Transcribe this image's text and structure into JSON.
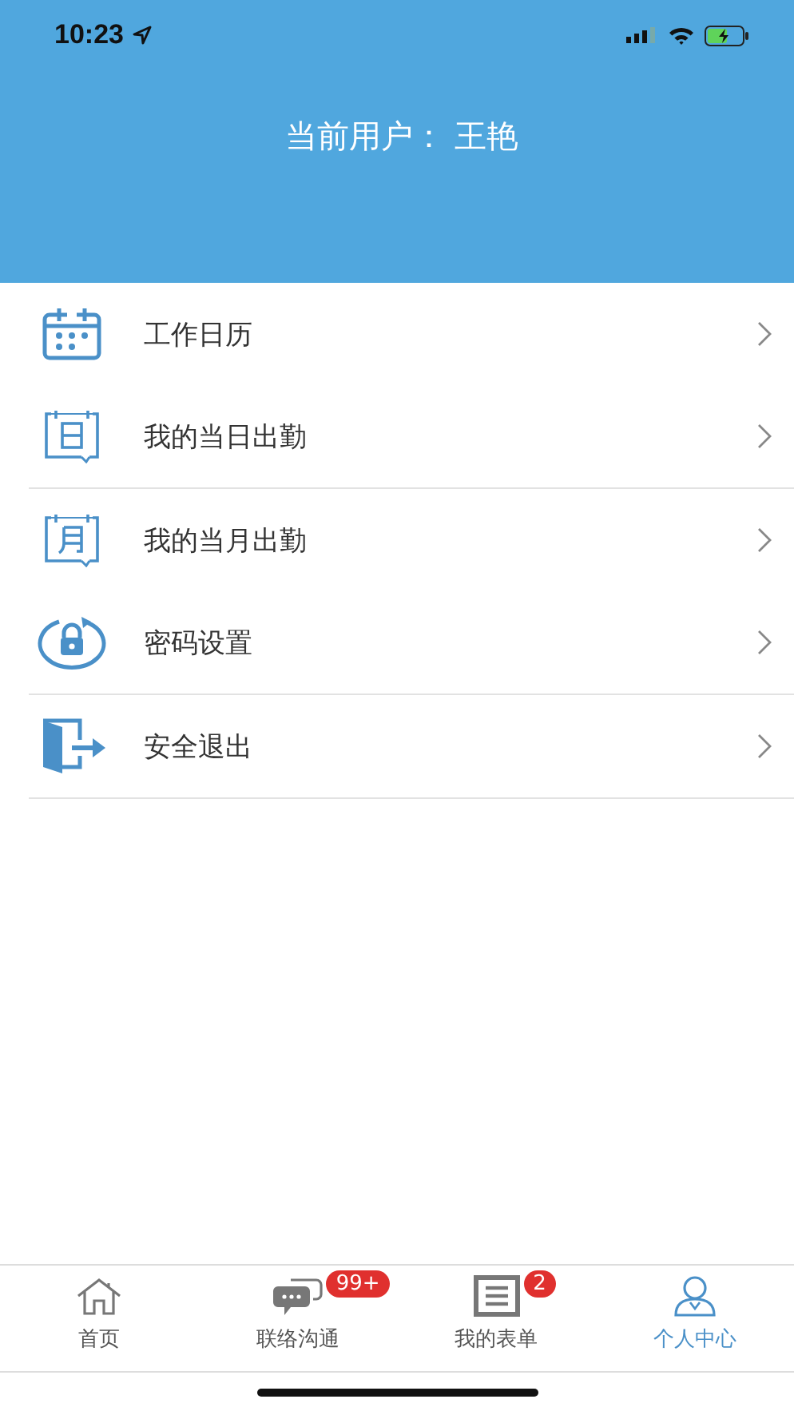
{
  "status_bar": {
    "time": "10:23"
  },
  "header": {
    "title": "当前用户： 王艳"
  },
  "menu_groups": [
    {
      "items": [
        {
          "label": "工作日历"
        },
        {
          "label": "我的当日出勤"
        }
      ]
    },
    {
      "items": [
        {
          "label": "我的当月出勤"
        },
        {
          "label": "密码设置"
        }
      ]
    },
    {
      "items": [
        {
          "label": "安全退出"
        }
      ]
    }
  ],
  "tab_bar": [
    {
      "label": "首页",
      "selected": false
    },
    {
      "label": "联络沟通",
      "selected": false,
      "badge": "99+"
    },
    {
      "label": "我的表单",
      "selected": false,
      "badge": "2"
    },
    {
      "label": "个人中心",
      "selected": true
    }
  ]
}
